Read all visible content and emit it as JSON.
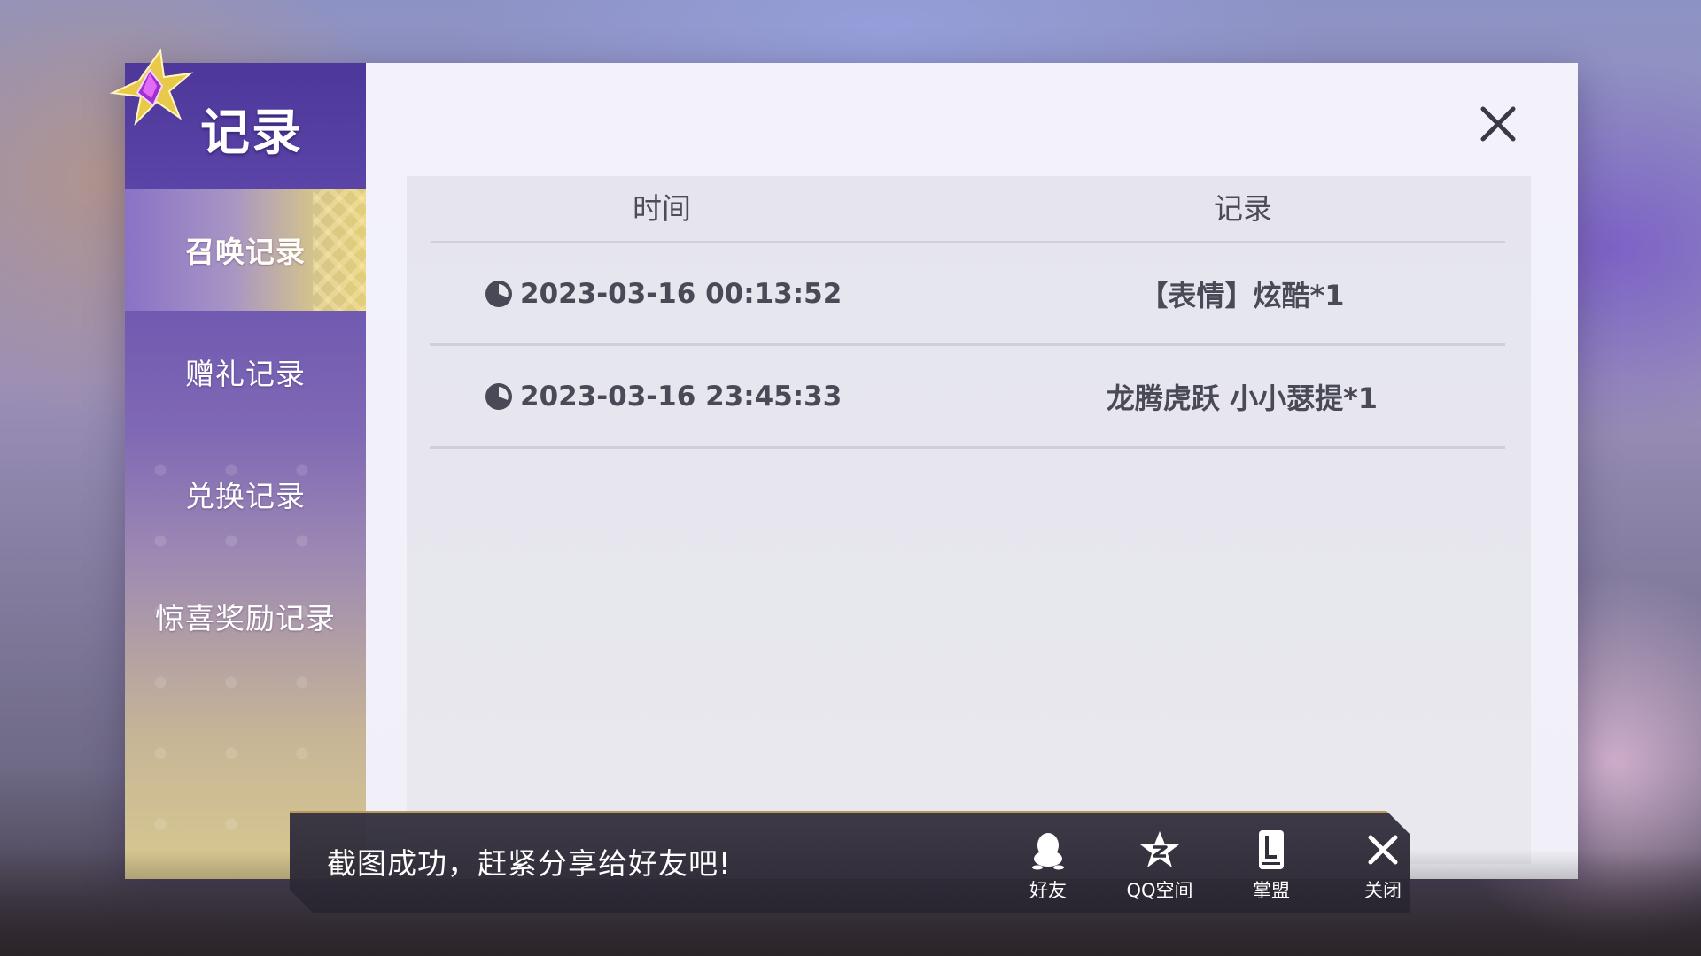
{
  "dialog": {
    "title": "记录",
    "close_icon": "close-icon",
    "sidebar": {
      "items": [
        {
          "label": "召唤记录",
          "active": true
        },
        {
          "label": "赠礼记录",
          "active": false
        },
        {
          "label": "兑换记录",
          "active": false
        },
        {
          "label": "惊喜奖励记录",
          "active": false
        }
      ]
    },
    "table": {
      "columns": [
        "时间",
        "记录"
      ],
      "rows": [
        {
          "time": "2023-03-16 00:13:52",
          "record": "【表情】炫酷*1"
        },
        {
          "time": "2023-03-16 23:45:33",
          "record": "龙腾虎跃 小小瑟提*1"
        }
      ]
    }
  },
  "share_toast": {
    "message": "截图成功，赶紧分享给好友吧!",
    "buttons": [
      {
        "label": "好友",
        "icon": "qq-penguin-icon"
      },
      {
        "label": "QQ空间",
        "icon": "qzone-star-icon"
      },
      {
        "label": "掌盟",
        "icon": "zhangmeng-icon"
      },
      {
        "label": "关闭",
        "icon": "close-icon"
      }
    ]
  },
  "colors": {
    "sidebar_top": "#4d379b",
    "active_tab_gold": "#e2cf7a",
    "content_bg": "#f3f2fb",
    "toast_bg": "#322e3c",
    "toast_border": "#b59a5c"
  }
}
